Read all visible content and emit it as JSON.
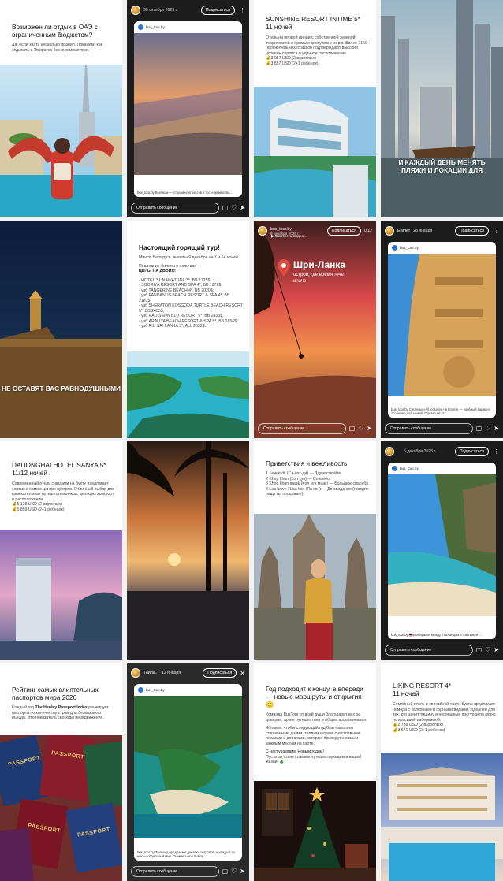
{
  "tiles": {
    "t1": {
      "title": "Возможен ли отдых в ОАЭ с ограниченным бюджетом?",
      "body": "Да, если знать несколько правил. Покажем, как отдыхать в Эмиратах без огромных трат."
    },
    "t2": {
      "date": "30 октября 2025 г.",
      "subscribe": "Подписаться",
      "account": "bus_tour.by",
      "caption": "bus_tour.by Вьетнам — страна контрастов и гостеприимства....",
      "send": "Отправить сообщение"
    },
    "t3": {
      "title": "SUNSHINE RESORT INTIME 5*",
      "subtitle": "11 ночей",
      "body": "Отель на первой линии с собственной зеленой территорией и прямым доступом к морю. Более 1150 положительных отзывов подтверждают высокий уровень сервиса и удачное расположение.",
      "price1": "💰3 057 USD (2 взрослых)",
      "price2": "💰3 857 USD (2+1 ребенок)"
    },
    "t4": {
      "overlay": "И КАЖДЫЙ ДЕНЬ МЕНЯТЬ ПЛЯЖИ И ЛОКАЦИИ ДЛЯ"
    },
    "t5": {
      "overlay": "НЕ ОСТАВЯТ ВАС РАВНОДУШНЫМИ"
    },
    "t6": {
      "title": "Настоящий горящий тур!",
      "intro": "Минск, Беларусь, вылеты 9 декабря на 7 и 14 ночей.",
      "stock": "Последние билеты в наличии!",
      "prices_head": "ЦЕНЫ НА ДВОИХ!",
      "lines": [
        "- HOTEL 3 UNAWATUNA 3*, BB 1775$;",
        "- SOORIYA RESORT AND SPA 4*, BB 1876$;",
        "- узб TANGERINE BEACH 4*, BB 2020$;",
        "- узб PANDANUS BEACH RESORT & SPA 4*, BB 2181$;",
        "- узб SHERATON KOSGODA TURTLE BEACH RESORT 5*, BB 2433$;",
        "- узб RADISSON BLU RESORT 5*, BB 2433$;",
        "- узб ARALIYA BEACH RESORT & SPA 5*, BB 2656$;",
        "- узб RIU SRI LANKA 5*, ALL 2632$."
      ]
    },
    "t7": {
      "account": "bus_tour.by",
      "date": "9 декабря 2025 г.",
      "watch": "Смотреть видео ...",
      "subscribe": "Подписаться",
      "time": "0:12",
      "country": "Шри-Ланка",
      "tagline": "остров, где время течет иначе",
      "send": "Отправить сообщение"
    },
    "t8": {
      "name": "Египет",
      "date": "28 января",
      "subscribe": "Подписаться",
      "account": "bus_tour.by",
      "caption": "bus_tour.by Система «All Inclusive» в Египте — удобный вариант, особенно для семей. Однако её уст...",
      "send": "Отправить сообщение"
    },
    "t9": {
      "title": "DADONGHAI HOTEL SANYA 5*",
      "subtitle": "11/12 ночей",
      "body": "Современный отель с видами на бухту предлагает сервис в самом центре курорта. Отличный выбор для взыскательных путешественников, ценящих комфорт и расположение.",
      "price1": "💰5 138 USD (2 взрослых)",
      "price2": "💰5 859 USD (2+1 ребенок)"
    },
    "t11": {
      "title": "Приветствия и вежливость",
      "lines": [
        "1 Sawat dii (Са-ват-ди) — Здравствуйте.",
        "2 Khop khun (Коп кун) — Спасибо.",
        "3 Khop khun maak (Коп кун маак) — Большое спасибо.",
        "4 Laa kawn / Laa kon (Ла кон) — До свидания (говорят чаще на прощание)."
      ]
    },
    "t12": {
      "date": "5 декабря 2025 г.",
      "subscribe": "Подписаться",
      "account": "bus_tour.by",
      "caption": "bus_tour.by 🇹🇭Выбираете между Таиландом и Хайнаней?...",
      "send": "Отправить сообщение"
    },
    "t13": {
      "title": "Рейтинг самых влиятельных паспортов мира 2026",
      "body_pre": "Каждый год ",
      "body_bold": "The Henley Passport Index",
      "body_post": " ранжирует паспорта по количеству стран для безвизового въезда. Это показатель свободы передвижения.",
      "passport": "PASSPORT"
    },
    "t14": {
      "name": "Таила...",
      "date": "12 января",
      "subscribe": "Подписаться",
      "account": "bus_tour.by",
      "caption": "bus_tour.by Таиланд предлагает десятки островов, и каждый из них — отдельный мир. Ошибиться в выбор...",
      "send": "Отправить сообщение"
    },
    "t15": {
      "title": "Год подходит к концу, а впереди — новые маршруты и открытия🙂",
      "body1": "Команда BusTour от всей души благодарит вас за доверие, яркие путешествия и общие воспоминания.",
      "body2": "Желаем, чтобы следующий год был наполнен солнечными днями, теплым морем, счастливыми планами и дорогами, которые приведут к самым важным местам на карте.",
      "ny_head": "С наступающим Новым годом!",
      "ny_body": "Пусть он станет самым путешествующим в вашей жизни. 🎄"
    },
    "t16": {
      "title": "LIKING RESORT 4*",
      "subtitle": "11 ночей",
      "body": "Семейный отель в спокойной части бухты предлагает номера с балконами и горными видами. Идеален для тех, кто ценит тишину и неспешные прогулки по морю по красивой набережной.",
      "price1": "💰2 788 USD (2 взрослых)",
      "price2": "💰3 671 USD (2+1 ребенок)"
    }
  },
  "colors": {
    "page": "#f2f2f2",
    "card": "#ffffff",
    "text": "#111111",
    "pin": "#e04a3c"
  }
}
